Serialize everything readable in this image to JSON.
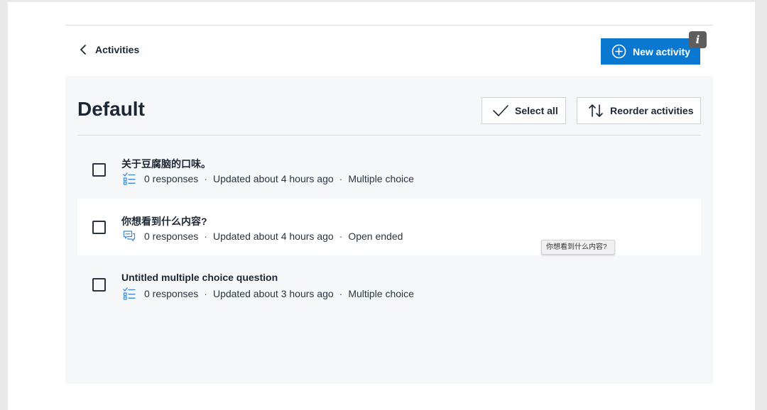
{
  "header": {
    "back_label": "Activities",
    "new_activity_label": "New activity",
    "info_badge": "i"
  },
  "main": {
    "title": "Default",
    "select_all_label": "Select all",
    "reorder_label": "Reorder activities"
  },
  "activities": [
    {
      "title": "关于豆腐脑的口味。",
      "responses": "0 responses",
      "updated": "Updated about 4 hours ago",
      "type": "Multiple choice",
      "icon": "multiple-choice-icon"
    },
    {
      "title": "你想看到什么内容?",
      "responses": "0 responses",
      "updated": "Updated about 4 hours ago",
      "type": "Open ended",
      "icon": "open-ended-icon"
    },
    {
      "title": "Untitled multiple choice question",
      "responses": "0 responses",
      "updated": "Updated about 3 hours ago",
      "type": "Multiple choice",
      "icon": "multiple-choice-icon"
    }
  ],
  "separator": "·",
  "tooltip": "你想看到什么内容?",
  "colors": {
    "accent": "#0a78d1",
    "text": "#1d2733",
    "panel_bg": "#f6f7f9"
  }
}
